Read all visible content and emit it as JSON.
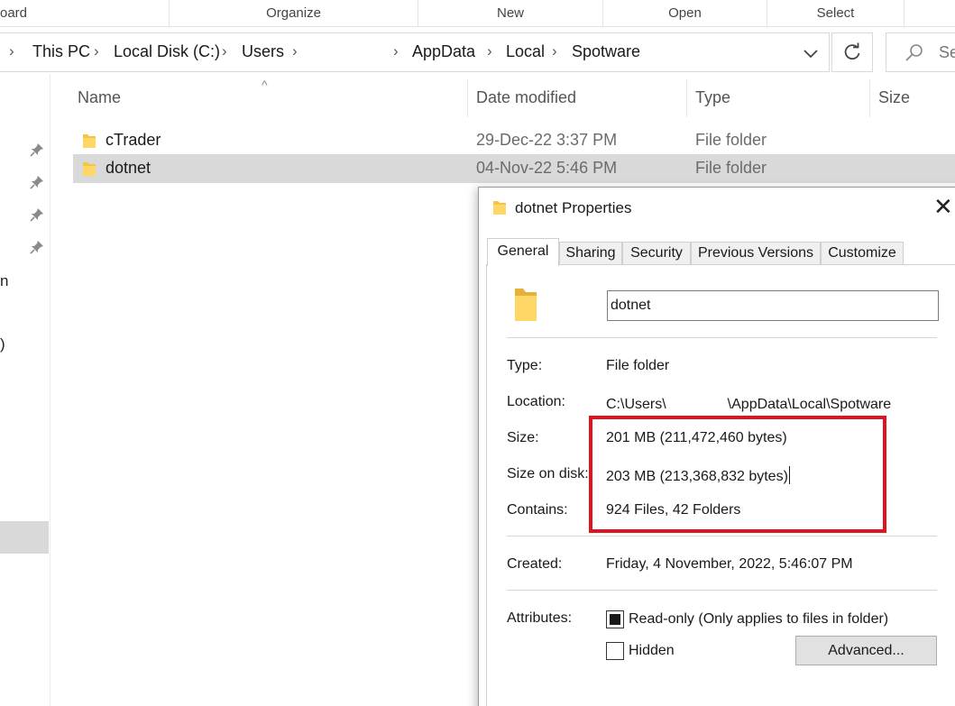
{
  "ribbon": {
    "groups": [
      "oard",
      "Organize",
      "New",
      "Open",
      "Select"
    ]
  },
  "address": {
    "crumbs": [
      "This PC",
      "Local Disk (C:)",
      "Users",
      "AppData",
      "Local",
      "Spotware"
    ],
    "chevron": "›",
    "dropdown_icon": "chevron-down-icon",
    "refresh_icon": "refresh-icon",
    "search_placeholder": "Se"
  },
  "nav": {
    "fragments": [
      "n",
      ")"
    ]
  },
  "columns": {
    "name": "Name",
    "date_modified": "Date modified",
    "type": "Type",
    "size": "Size",
    "sort_indicator": "^"
  },
  "files": [
    {
      "name": "cTrader",
      "date": "29-Dec-22 3:37 PM",
      "type": "File folder",
      "selected": false
    },
    {
      "name": "dotnet",
      "date": "04-Nov-22 5:46 PM",
      "type": "File folder",
      "selected": true
    }
  ],
  "dialog": {
    "title": "dotnet Properties",
    "close_glyph": "✕",
    "tabs": [
      "General",
      "Sharing",
      "Security",
      "Previous Versions",
      "Customize"
    ],
    "active_tab": "General",
    "folder_name": "dotnet",
    "labels": {
      "type": "Type:",
      "location": "Location:",
      "size": "Size:",
      "size_on_disk": "Size on disk:",
      "contains": "Contains:",
      "created": "Created:",
      "attributes": "Attributes:"
    },
    "values": {
      "type": "File folder",
      "location_start": "C:\\Users\\",
      "location_end": "\\AppData\\Local\\Spotware",
      "size": "201 MB (211,472,460 bytes)",
      "size_on_disk": "203 MB (213,368,832 bytes)",
      "contains": "924 Files, 42 Folders",
      "created": "Friday, 4 November, 2022, 5:46:07 PM"
    },
    "attributes": {
      "readonly_label": "Read-only (Only applies to files in folder)",
      "readonly_state": "indeterminate",
      "hidden_label": "Hidden",
      "hidden_checked": false
    },
    "advanced_button": "Advanced...",
    "highlight_color": "#e0141e"
  },
  "colors": {
    "folder": "#f5c542",
    "selection": "#d9d9d9"
  }
}
